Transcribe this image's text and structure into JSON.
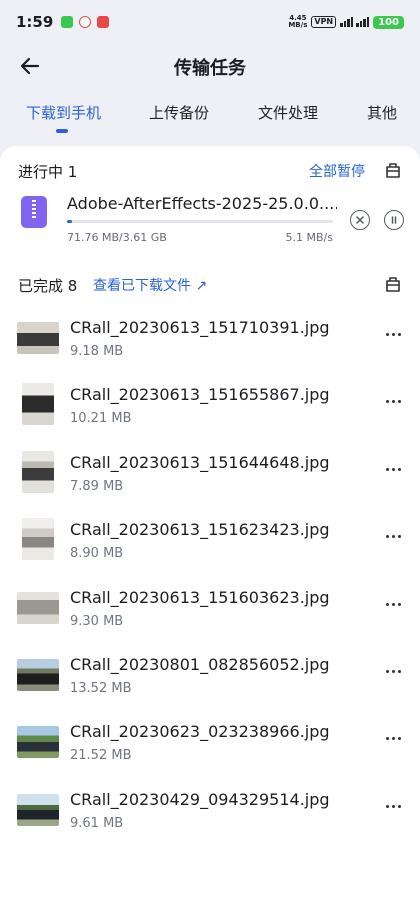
{
  "status_bar": {
    "time": "1:59",
    "net_speed_value": "4.45",
    "net_speed_unit": "MB/s",
    "vpn_label": "VPN",
    "battery": "100",
    "notification_colors": [
      "#3ac84e",
      "#e84848",
      "#e84848"
    ]
  },
  "header": {
    "title": "传输任务",
    "back_icon": "arrow-left-icon"
  },
  "tabs": [
    {
      "label": "下载到手机",
      "active": true
    },
    {
      "label": "上传备份",
      "active": false
    },
    {
      "label": "文件处理",
      "active": false
    },
    {
      "label": "其他",
      "active": false
    }
  ],
  "in_progress": {
    "heading": "进行中 1",
    "pause_all_label": "全部暂停",
    "tool_icon": "toolbox-icon",
    "item": {
      "name": "Adobe-AfterEffects-2025-25.0.0....",
      "size_progress": "71.76 MB/3.61 GB",
      "speed": "5.1 MB/s",
      "progress_fraction": 0.0194,
      "file_icon": "zip-file-icon"
    }
  },
  "completed": {
    "heading": "已完成 8",
    "view_link_label": "查看已下载文件",
    "tool_icon": "toolbox-icon",
    "files": [
      {
        "name": "CRall_20230613_151710391.jpg",
        "size": "9.18 MB"
      },
      {
        "name": "CRall_20230613_151655867.jpg",
        "size": "10.21 MB"
      },
      {
        "name": "CRall_20230613_151644648.jpg",
        "size": "7.89 MB"
      },
      {
        "name": "CRall_20230613_151623423.jpg",
        "size": "8.90 MB"
      },
      {
        "name": "CRall_20230613_151603623.jpg",
        "size": "9.30 MB"
      },
      {
        "name": "CRall_20230801_082856052.jpg",
        "size": "13.52 MB"
      },
      {
        "name": "CRall_20230623_023238966.jpg",
        "size": "21.52 MB"
      },
      {
        "name": "CRall_20230429_094329514.jpg",
        "size": "9.61 MB"
      }
    ]
  },
  "colors": {
    "accent": "#2a63d8",
    "background": "#eef0f6",
    "card": "#ffffff",
    "zip_icon": "#8064f0",
    "battery": "#3ac84e"
  }
}
